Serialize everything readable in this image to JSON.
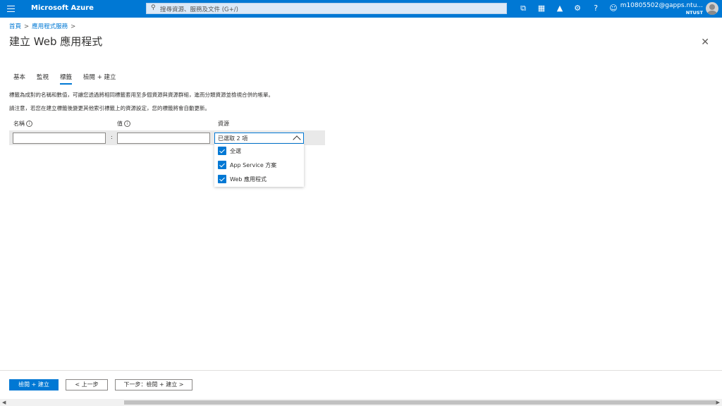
{
  "topbar": {
    "brand": "Microsoft Azure",
    "search_placeholder": "搜尋資源、服務及文件 (G+/)",
    "user_email": "m10805502@gapps.ntu...",
    "user_org": "NTUST",
    "icons": [
      "cloud-shell-icon",
      "directory-filter-icon",
      "notifications-icon",
      "settings-icon",
      "help-icon",
      "feedback-icon"
    ],
    "accent": "#0078d4"
  },
  "breadcrumb": {
    "home": "首頁",
    "services": "應用程式服務"
  },
  "page_title": "建立 Web 應用程式",
  "tabs": [
    {
      "label": "基本",
      "active": false
    },
    {
      "label": "監視",
      "active": false
    },
    {
      "label": "標籤",
      "active": true
    },
    {
      "label": "檢閱 + 建立",
      "active": false
    }
  ],
  "description": {
    "line1": "標籤為成對的名稱和數值，可讓您透過將相同標籤套用至多個資源與資源群組，進而分類資源並檢視合併的帳單。",
    "line2": "請注意，若您在建立標籤後變更其他索引標籤上的資源設定，您的標籤將會自動更新。"
  },
  "grid": {
    "name_header": "名稱",
    "value_header": "值",
    "resource_header": "資源",
    "separator": ":",
    "name_value": "",
    "value_value": "",
    "resource_selected": "已選取 2 項"
  },
  "dropdown": {
    "options": [
      {
        "label": "全選",
        "checked": true
      },
      {
        "label": "App Service 方案",
        "checked": true
      },
      {
        "label": "Web 應用程式",
        "checked": true
      }
    ]
  },
  "footer": {
    "review_create": "檢閱 + 建立",
    "previous": "< 上一步",
    "next": "下一步：檢閱 + 建立 >"
  }
}
